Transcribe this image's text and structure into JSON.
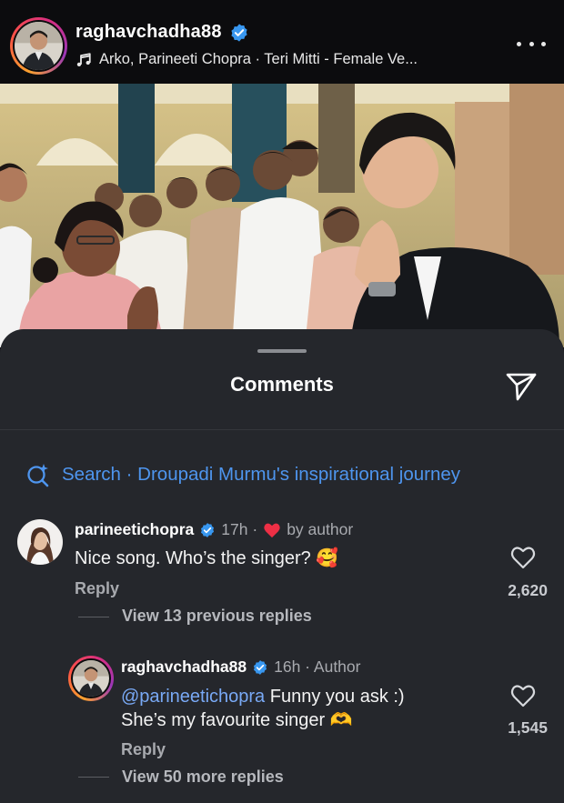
{
  "post": {
    "username": "raghavchadha88",
    "music": "Arko, Parineeti Chopra · Teri Mitti - Female Ve...",
    "icons": {
      "verified": "verified-badge-icon",
      "music": "music-note-icon",
      "more": "more-options-icon"
    }
  },
  "comments_sheet": {
    "title": "Comments",
    "search_text": "Search · Droupadi Murmu's inspirational journey",
    "comments": [
      {
        "username": "parineetichopra",
        "time": "17h ·",
        "liked_by": "by author",
        "text": "Nice song. Who’s the singer?",
        "emoji": "🥰",
        "reply_label": "Reply",
        "like_count": "2,620",
        "view_replies": "View 13 previous replies"
      },
      {
        "username": "raghavchadha88",
        "time": "16h · Author",
        "mention": "@parineetichopra",
        "text_line1": "Funny you ask :)",
        "text_line2": "She’s my favourite singer",
        "emoji": "🫶",
        "reply_label": "Reply",
        "like_count": "1,545",
        "view_replies": "View 50 more replies"
      }
    ]
  },
  "colors": {
    "accent_blue": "#4e95ee",
    "verified_blue": "#3897f0",
    "heart_red": "#ed2f45",
    "sheet_bg": "#25272c"
  }
}
